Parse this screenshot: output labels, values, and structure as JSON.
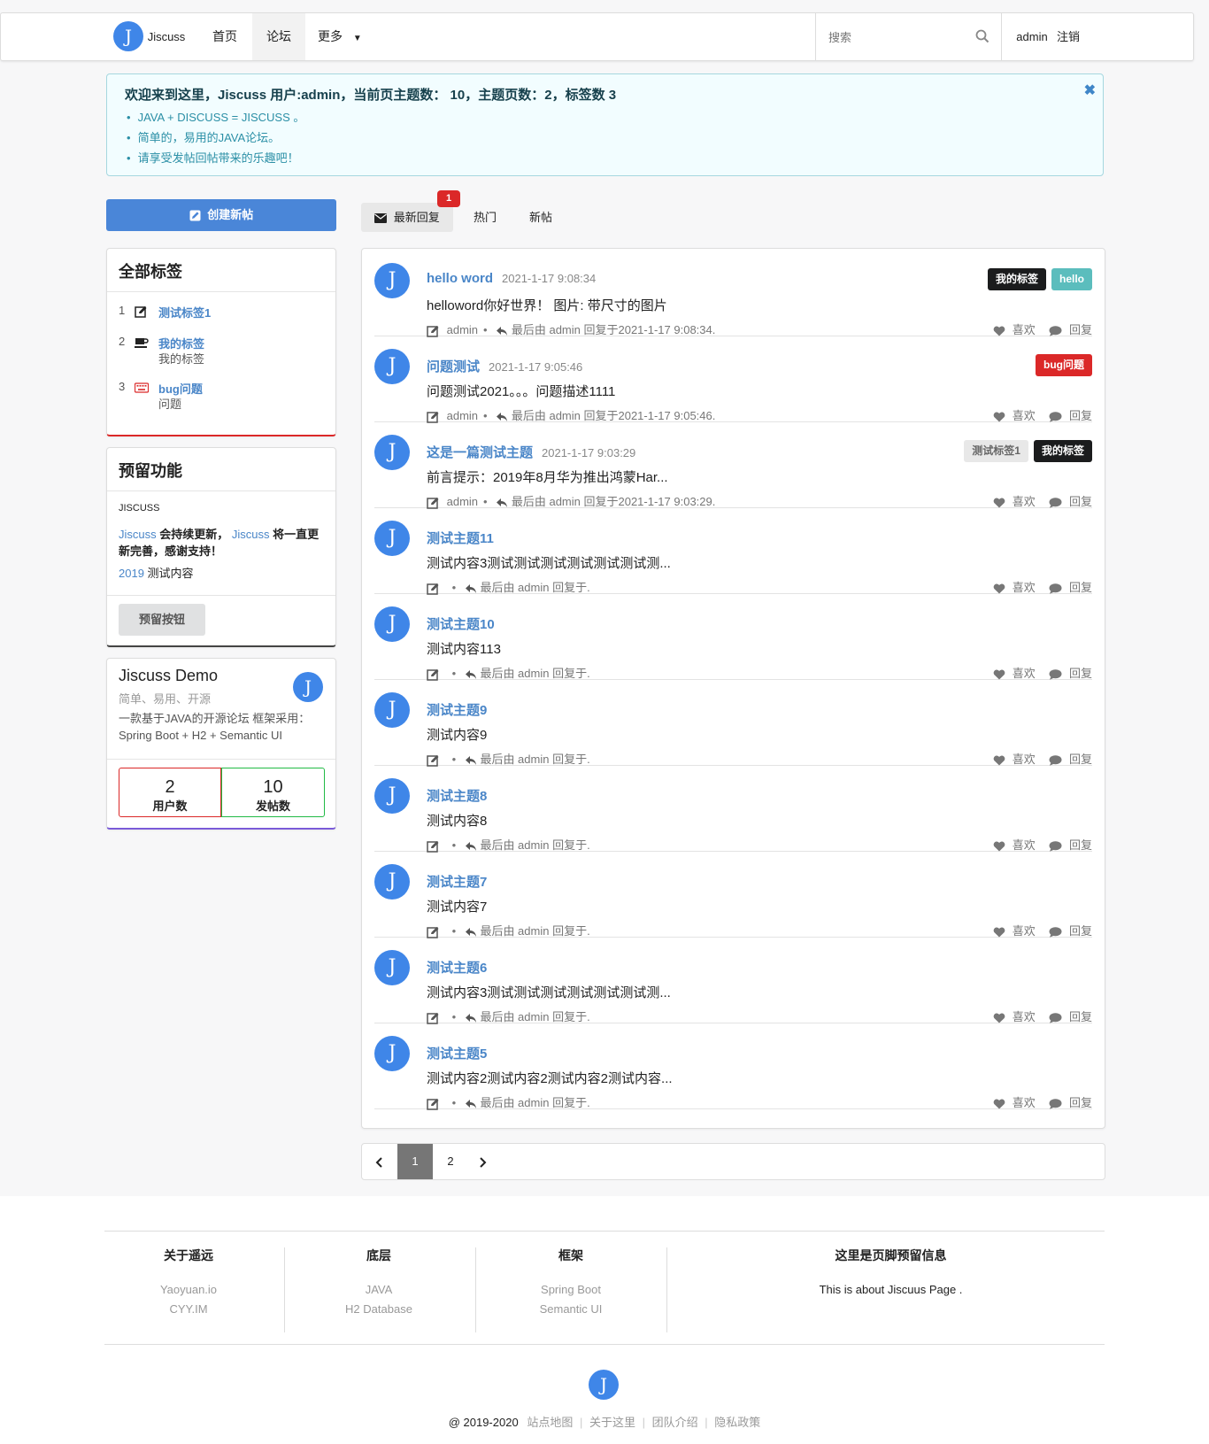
{
  "nav": {
    "logo_text": "Jiscuss",
    "logo_letter": "J",
    "home": "首页",
    "forum": "论坛",
    "more": "更多",
    "search_placeholder": "搜索",
    "user": "admin",
    "logout": "注销"
  },
  "notice": {
    "title": "欢迎来到这里，Jiscuss 用户:admin，当前页主题数： 10，主题页数：2，标签数 3",
    "items": [
      "JAVA + DISCUSS = JISCUSS 。",
      "简单的，易用的JAVA论坛。",
      "请享受发帖回帖带来的乐趣吧！"
    ]
  },
  "sidebar": {
    "create_button": "创建新帖",
    "tags_title": "全部标签",
    "tags": [
      {
        "num": "1",
        "name": "测试标签1",
        "desc": "",
        "icon": "edit-icon"
      },
      {
        "num": "2",
        "name": "我的标签",
        "desc": "我的标签",
        "icon": "coffee-icon"
      },
      {
        "num": "3",
        "name": "bug问题",
        "desc": "问题",
        "icon": "keyboard-icon"
      }
    ],
    "reserve_title": "预留功能",
    "reserve_subtitle": "JISCUSS",
    "reserve_line1_a": "Jiscuss",
    "reserve_line1_b": " 会持续更新， ",
    "reserve_line1_c": "Jiscuss",
    "reserve_line1_d": " 将一直更新完善，感谢支持！",
    "reserve_line2_a": "2019",
    "reserve_line2_b": " 测试内容",
    "reserve_button": "预留按钮",
    "demo_title": "Jiscuss Demo",
    "demo_meta": "简单、易用、开源",
    "demo_desc": "一款基于JAVA的开源论坛 框架采用：Spring Boot + H2 + Semantic UI",
    "stat_users_value": "2",
    "stat_users_label": "用户数",
    "stat_posts_value": "10",
    "stat_posts_label": "发帖数"
  },
  "tabs": {
    "latest": "最新回复",
    "latest_badge": "1",
    "hot": "热门",
    "new": "新帖"
  },
  "topics": [
    {
      "title": "hello word",
      "time": "2021-1-17 9:08:34",
      "content": "helloword你好世界！ 图片: 带尺寸的图片",
      "author": "admin",
      "reply": "最后由 admin 回复于2021-1-17 9:08:34.",
      "labels": [
        {
          "text": "我的标签",
          "style": "black"
        },
        {
          "text": "hello",
          "style": "teal"
        }
      ]
    },
    {
      "title": "问题测试",
      "time": "2021-1-17 9:05:46",
      "content": "问题测试2021。。。问题描述1111",
      "author": "admin",
      "reply": "最后由 admin 回复于2021-1-17 9:05:46.",
      "labels": [
        {
          "text": "bug问题",
          "style": "red"
        }
      ]
    },
    {
      "title": "这是一篇测试主题",
      "time": "2021-1-17 9:03:29",
      "content": "前言提示：2019年8月华为推出鸿蒙Har...",
      "author": "admin",
      "reply": "最后由 admin 回复于2021-1-17 9:03:29.",
      "labels": [
        {
          "text": "测试标签1",
          "style": "grey"
        },
        {
          "text": "我的标签",
          "style": "black"
        }
      ]
    },
    {
      "title": "测试主题11",
      "time": "",
      "content": "测试内容3测试测试测试测试测试测试测...",
      "author": "",
      "reply": "最后由 admin 回复于.",
      "labels": []
    },
    {
      "title": "测试主题10",
      "time": "",
      "content": "测试内容113",
      "author": "",
      "reply": "最后由 admin 回复于.",
      "labels": []
    },
    {
      "title": "测试主题9",
      "time": "",
      "content": "测试内容9",
      "author": "",
      "reply": "最后由 admin 回复于.",
      "labels": []
    },
    {
      "title": "测试主题8",
      "time": "",
      "content": "测试内容8",
      "author": "",
      "reply": "最后由 admin 回复于.",
      "labels": []
    },
    {
      "title": "测试主题7",
      "time": "",
      "content": "测试内容7",
      "author": "",
      "reply": "最后由 admin 回复于.",
      "labels": []
    },
    {
      "title": "测试主题6",
      "time": "",
      "content": "测试内容3测试测试测试测试测试测试测...",
      "author": "",
      "reply": "最后由 admin 回复于.",
      "labels": []
    },
    {
      "title": "测试主题5",
      "time": "",
      "content": "测试内容2测试内容2测试内容2测试内容...",
      "author": "",
      "reply": "最后由 admin 回复于.",
      "labels": []
    }
  ],
  "topic_actions": {
    "like": "喜欢",
    "reply": "回复"
  },
  "pagination": {
    "current": "1",
    "next_page": "2"
  },
  "footer": {
    "col1_title": "关于遥远",
    "col1_links": [
      "Yaoyuan.io",
      "CYY.IM"
    ],
    "col2_title": "底层",
    "col2_links": [
      "JAVA",
      "H2 Database"
    ],
    "col3_title": "框架",
    "col3_links": [
      "Spring Boot",
      "Semantic UI"
    ],
    "col4_title": "这里是页脚预留信息",
    "col4_text": "This is about Jiscuus Page .",
    "copyright": "@ 2019-2020",
    "links": [
      "站点地图",
      "关于这里",
      "团队介绍",
      "隐私政策"
    ]
  },
  "colors": {
    "primary": "#4a86d8",
    "link": "#4a86c8",
    "danger": "#db2828",
    "logo": "#3f86e8"
  }
}
